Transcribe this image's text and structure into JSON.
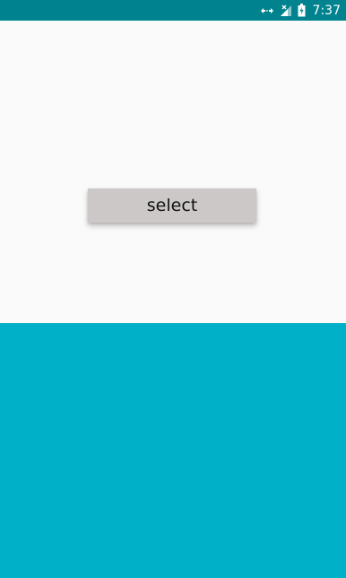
{
  "status_bar": {
    "time": "7:37",
    "background_color": "#00838f",
    "icons": [
      "data-transfer-icon",
      "signal-no-service-icon",
      "battery-charging-icon"
    ]
  },
  "main": {
    "select_button_label": "select",
    "top_panel_color": "#fafafa",
    "bottom_panel_color": "#00afc8",
    "button_color": "#ccc8c8"
  }
}
